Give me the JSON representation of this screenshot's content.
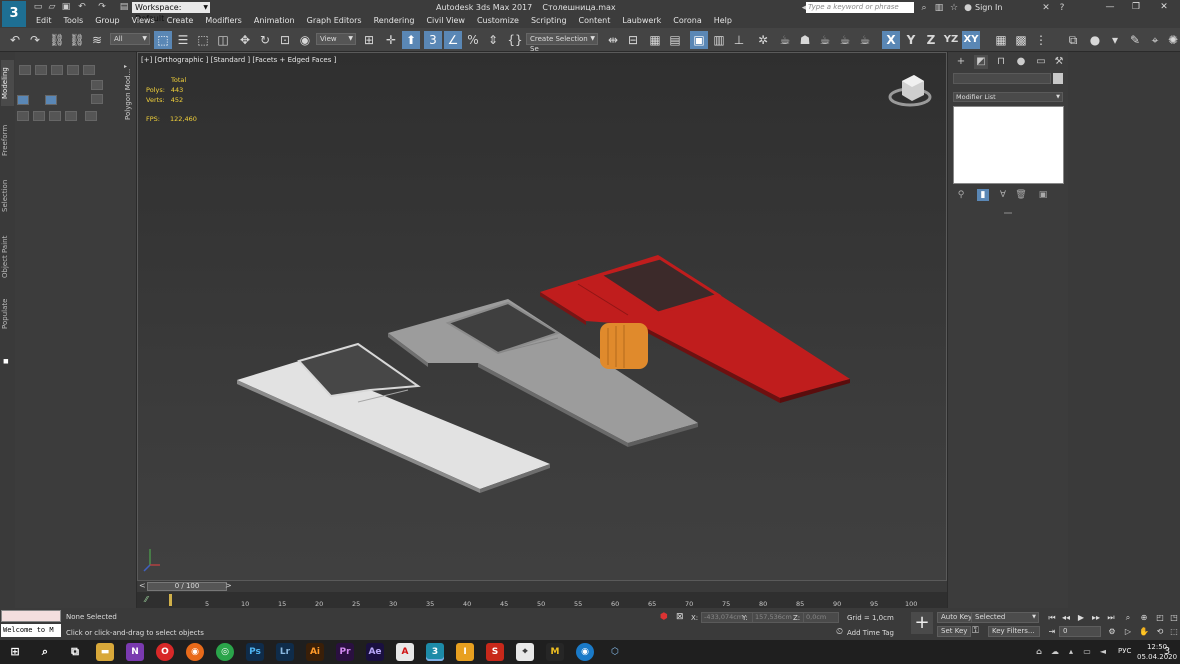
{
  "titlebar": {
    "app_logo": "3",
    "workspace": "Workspace: Default",
    "app_title": "Autodesk 3ds Max 2017",
    "file_name": "Столешница.max",
    "search_placeholder": "Type a keyword or phrase",
    "sign_in": "Sign In"
  },
  "menu": [
    "Edit",
    "Tools",
    "Group",
    "Views",
    "Create",
    "Modifiers",
    "Animation",
    "Graph Editors",
    "Rendering",
    "Civil View",
    "Customize",
    "Scripting",
    "Content",
    "Laubwerk",
    "Corona",
    "Help"
  ],
  "toolbar": {
    "filter_dropdown": "All",
    "refcoord_dropdown": "View",
    "named_selection": "Create Selection Se",
    "axis_x": "X",
    "axis_y": "Y",
    "axis_z": "Z",
    "axis_yz": "YZ",
    "axis_xy": "XY"
  },
  "left_tabs": [
    "Modeling",
    "Freeform",
    "Selection",
    "Object Paint",
    "Populate"
  ],
  "ribbon_label": "Polygon Mod...",
  "viewport": {
    "label": "[+] [Orthographic ] [Standard ] [Facets + Edged Faces ]",
    "stats": {
      "header": "Total",
      "polys_label": "Polys:",
      "polys_value": "443",
      "verts_label": "Verts:",
      "verts_value": "452",
      "fps_label": "FPS:",
      "fps_value": "122,460"
    },
    "object_colors": {
      "white_countertop": "#e2e2e2",
      "grey_countertop": "#9c9c9c",
      "red_countertop": "#c01d1d",
      "orange_box": "#e08a2c"
    }
  },
  "time_slider": {
    "frame_display": "0 / 100",
    "prev_symbol": "<",
    "next_symbol": ">"
  },
  "track_ticks": [
    "5",
    "10",
    "15",
    "20",
    "25",
    "30",
    "35",
    "40",
    "45",
    "50",
    "55",
    "60",
    "65",
    "70",
    "75",
    "80",
    "85",
    "90",
    "95",
    "100"
  ],
  "status": {
    "listener_text": "Welcome to M",
    "selection": "None Selected",
    "prompt": "Click or click-and-drag to select objects",
    "x_label": "X:",
    "x_value": "-433,074cm",
    "y_label": "Y:",
    "y_value": "157,536cm",
    "z_label": "Z:",
    "z_value": "0,0cm",
    "grid": "Grid = 1,0cm",
    "add_time_tag": "Add Time Tag",
    "auto_key": "Auto Key",
    "set_key": "Set Key",
    "selected_dd": "Selected",
    "key_filters": "Key Filters...",
    "frame_field": "0"
  },
  "right_panel": {
    "modifier_list": "Modifier List"
  },
  "taskbar": {
    "language": "РУС",
    "time": "12:50",
    "date": "05.04.2020",
    "notifications": "3"
  }
}
